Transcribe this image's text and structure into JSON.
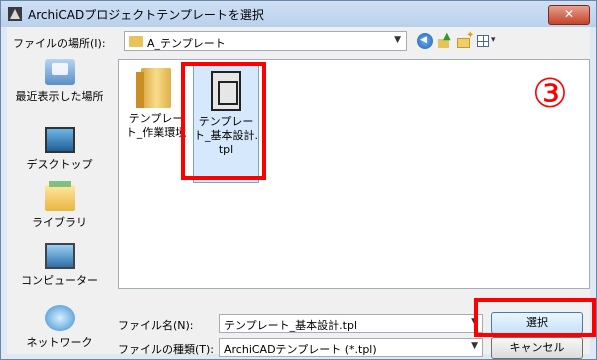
{
  "window": {
    "title": "ArchiCADプロジェクトテンプレートを選択",
    "close_label": "✕"
  },
  "lookin": {
    "label": "ファイルの場所(I):",
    "value": "A_テンプレート"
  },
  "places": [
    {
      "label": "最近表示した場所",
      "icon": "recent-places-icon"
    },
    {
      "label": "デスクトップ",
      "icon": "desktop-icon"
    },
    {
      "label": "ライブラリ",
      "icon": "library-icon"
    },
    {
      "label": "コンピューター",
      "icon": "computer-icon"
    },
    {
      "label": "ネットワーク",
      "icon": "network-icon"
    }
  ],
  "files": [
    {
      "line1": "テンプレー",
      "line2": "ト_作業環境",
      "line3": "",
      "icon": "folder-icon",
      "selected": false
    },
    {
      "line1": "テンプレー",
      "line2": "ト_基本設計.",
      "line3": "tpl",
      "icon": "template-file-icon",
      "selected": true
    }
  ],
  "annotation": {
    "step_marker": "③",
    "highlight_color": "#ff0000"
  },
  "filename": {
    "label": "ファイル名(N):",
    "value": "テンプレート_基本設計.tpl"
  },
  "filetype": {
    "label": "ファイルの種類(T):",
    "value": "ArchiCADテンプレート (*.tpl)"
  },
  "buttons": {
    "ok_label": "選択",
    "cancel_label": "キャンセル"
  }
}
